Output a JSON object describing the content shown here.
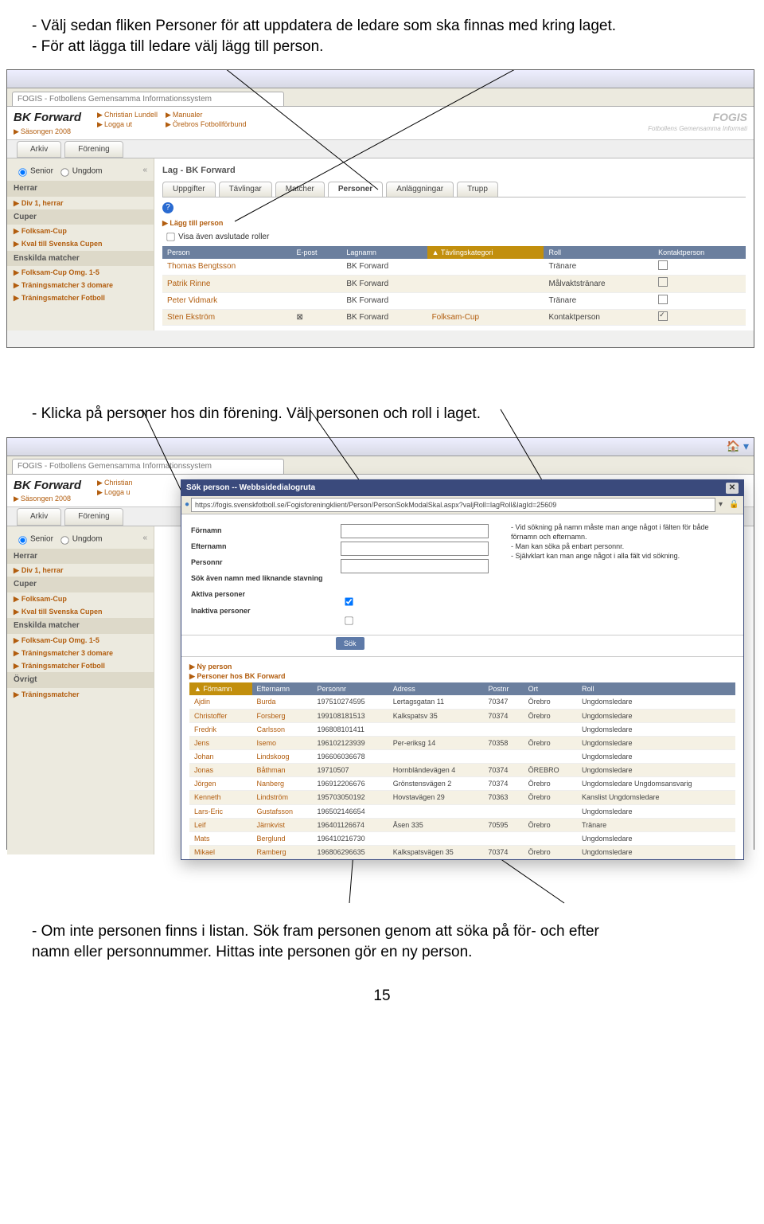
{
  "instructions": {
    "i1": "- Välj sedan fliken Personer för att uppdatera de ledare som ska finnas med kring laget.",
    "i2": "- För att lägga till ledare välj lägg till person.",
    "i3": "- Klicka på personer hos din förening. Välj personen och roll i laget.",
    "i4a": "- Om inte personen finns i listan. Sök fram personen genom att söka på för- och efter",
    "i4b": "namn eller personnummer. Hittas inte personen gör en ny person."
  },
  "brand": {
    "name": "BK Forward",
    "season_label": "Säsongen 2008"
  },
  "toplinks": {
    "a": "Christian Lundell",
    "b": "Manualer",
    "c": "Logga ut",
    "d": "Örebros Fotbollförbund"
  },
  "fogis": {
    "label": "FOGIS",
    "sub": "Fotbollens Gemensamma Informati"
  },
  "menus": {
    "arkiv": "Arkiv",
    "forening": "Förening"
  },
  "browsertab": {
    "title": "FOGIS - Fotbollens Gemensamma Informationssystem"
  },
  "sidebar": {
    "radio": {
      "senior": "Senior",
      "ungdom": "Ungdom"
    },
    "herrar": "Herrar",
    "div1": "Div 1, herrar",
    "cuper": "Cuper",
    "folksam": "Folksam-Cup",
    "kval": "Kval till Svenska Cupen",
    "enskilda": "Enskilda matcher",
    "fco": "Folksam-Cup Omg. 1-5",
    "tm3": "Träningsmatcher 3 domare",
    "tmf": "Träningsmatcher Fotboll",
    "ovrigt": "Övrigt",
    "tm": "Träningsmatcher"
  },
  "content": {
    "title": "Lag - BK Forward",
    "tabs": {
      "uppg": "Uppgifter",
      "tav": "Tävlingar",
      "mat": "Matcher",
      "per": "Personer",
      "anl": "Anläggningar",
      "trupp": "Trupp"
    },
    "add": "Lägg till person",
    "chk": "Visa även avslutade roller",
    "cols": {
      "person": "Person",
      "epost": "E-post",
      "lag": "Lagnamn",
      "tav": "Tävlingskategori",
      "roll": "Roll",
      "kontakt": "Kontaktperson"
    },
    "rows": [
      {
        "p": "Thomas Bengtsson",
        "e": "",
        "l": "BK Forward",
        "t": "",
        "r": "Tränare",
        "k": false
      },
      {
        "p": "Patrik Rinne",
        "e": "",
        "l": "BK Forward",
        "t": "",
        "r": "Målvaktstränare",
        "k": false
      },
      {
        "p": "Peter Vidmark",
        "e": "",
        "l": "BK Forward",
        "t": "",
        "r": "Tränare",
        "k": false
      },
      {
        "p": "Sten Ekström",
        "e": "✉",
        "l": "BK Forward",
        "t": "Folksam-Cup",
        "r": "Kontaktperson",
        "k": true
      }
    ]
  },
  "dialog": {
    "title": "Sök person -- Webbsidedialogruta",
    "url": "https://fogis.svenskfotboll.se/Fogisforeningklient/Person/PersonSokModalSkal.aspx?valjRoll=lagRoll&lagId=25609",
    "labels": {
      "fn": "Förnamn",
      "en": "Efternamn",
      "pn": "Personnr",
      "sok": "Sök även namn med liknande stavning",
      "akt": "Aktiva personer",
      "inakt": "Inaktiva personer"
    },
    "notes": {
      "n1": "- Vid sökning på namn måste man ange något i fälten för både förnamn och efternamn.",
      "n2": "- Man kan söka på enbart personnr.",
      "n3": "- Självklart kan man ange något i alla fält vid sökning."
    },
    "btn": "Sök",
    "ny": "Ny person",
    "hos": "Personer hos BK Forward",
    "cols": {
      "fn": "Förnamn",
      "en": "Efternamn",
      "pn": "Personnr",
      "ad": "Adress",
      "po": "Postnr",
      "ort": "Ort",
      "roll": "Roll"
    },
    "rows": [
      {
        "fn": "Ajdin",
        "en": "Burda",
        "pn": "197510274595",
        "ad": "Lertagsgatan 11",
        "po": "70347",
        "ort": "Örebro",
        "roll": "Ungdomsledare"
      },
      {
        "fn": "Christoffer",
        "en": "Forsberg",
        "pn": "199108181513",
        "ad": "Kalkspatsv 35",
        "po": "70374",
        "ort": "Örebro",
        "roll": "Ungdomsledare"
      },
      {
        "fn": "Fredrik",
        "en": "Carlsson",
        "pn": "196808101411",
        "ad": "",
        "po": "",
        "ort": "",
        "roll": "Ungdomsledare"
      },
      {
        "fn": "Jens",
        "en": "Isemo",
        "pn": "196102123939",
        "ad": "Per-eriksg 14",
        "po": "70358",
        "ort": "Örebro",
        "roll": "Ungdomsledare"
      },
      {
        "fn": "Johan",
        "en": "Lindskoog",
        "pn": "196606036678",
        "ad": "",
        "po": "",
        "ort": "",
        "roll": "Ungdomsledare"
      },
      {
        "fn": "Jonas",
        "en": "Båthman",
        "pn": "19710507",
        "ad": "Hornbländevägen 4",
        "po": "70374",
        "ort": "ÖREBRO",
        "roll": "Ungdomsledare"
      },
      {
        "fn": "Jörgen",
        "en": "Nanberg",
        "pn": "196912206676",
        "ad": "Grönstensvägen 2",
        "po": "70374",
        "ort": "Örebro",
        "roll": "Ungdomsledare Ungdomsansvarig"
      },
      {
        "fn": "Kenneth",
        "en": "Lindström",
        "pn": "195703050192",
        "ad": "Hovstavägen 29",
        "po": "70363",
        "ort": "Örebro",
        "roll": "Kanslist Ungdomsledare"
      },
      {
        "fn": "Lars-Eric",
        "en": "Gustafsson",
        "pn": "196502146654",
        "ad": "",
        "po": "",
        "ort": "",
        "roll": "Ungdomsledare"
      },
      {
        "fn": "Leif",
        "en": "Järnkvist",
        "pn": "196401126674",
        "ad": "Åsen 335",
        "po": "70595",
        "ort": "Örebro",
        "roll": "Tränare"
      },
      {
        "fn": "Mats",
        "en": "Berglund",
        "pn": "196410216730",
        "ad": "",
        "po": "",
        "ort": "",
        "roll": "Ungdomsledare"
      },
      {
        "fn": "Mikael",
        "en": "Ramberg",
        "pn": "196806296635",
        "ad": "Kalkspatsvägen 35",
        "po": "70374",
        "ort": "Örebro",
        "roll": "Ungdomsledare"
      }
    ]
  },
  "page": "15"
}
